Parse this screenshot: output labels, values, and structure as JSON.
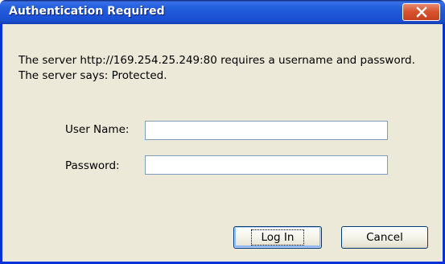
{
  "window": {
    "title": "Authentication Required",
    "close_icon": "close-x-icon"
  },
  "message": {
    "text": "The server http://169.254.25.249:80 requires a username and password. The server says: Protected."
  },
  "form": {
    "username_label": "User Name:",
    "username_value": "",
    "password_label": "Password:",
    "password_value": ""
  },
  "buttons": {
    "login_label": "Log In",
    "cancel_label": "Cancel"
  },
  "colors": {
    "titlebar": "#1d55d6",
    "client_bg": "#ece9d8",
    "close_button": "#d8552f"
  }
}
